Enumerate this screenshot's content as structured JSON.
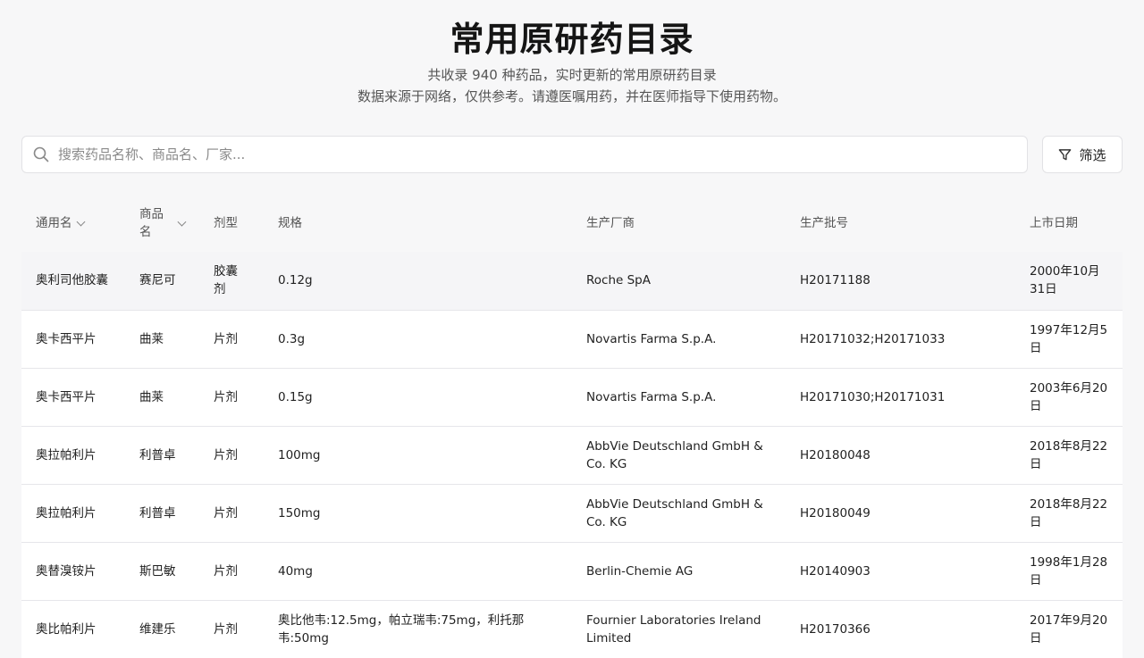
{
  "header": {
    "title": "常用原研药目录",
    "subtitle_line1": "共收录 940 种药品，实时更新的常用原研药目录",
    "subtitle_line2": "数据来源于网络，仅供参考。请遵医嘱用药，并在医师指导下使用药物。"
  },
  "search": {
    "placeholder": "搜索药品名称、商品名、厂家...",
    "value": ""
  },
  "filter": {
    "label": "筛选"
  },
  "table": {
    "columns": [
      "通用名",
      "商品名",
      "剂型",
      "规格",
      "生产厂商",
      "生产批号",
      "上市日期"
    ],
    "rows": [
      [
        "奥利司他胶囊",
        "赛尼可",
        "胶囊剂",
        "0.12g",
        "Roche SpA",
        "H20171188",
        "2000年10月31日"
      ],
      [
        "奥卡西平片",
        "曲莱",
        "片剂",
        "0.3g",
        "Novartis Farma S.p.A.",
        "H20171032;H20171033",
        "1997年12月5日"
      ],
      [
        "奥卡西平片",
        "曲莱",
        "片剂",
        "0.15g",
        "Novartis Farma S.p.A.",
        "H20171030;H20171031",
        "2003年6月20日"
      ],
      [
        "奥拉帕利片",
        "利普卓",
        "片剂",
        "100mg",
        "AbbVie Deutschland GmbH & Co. KG",
        "H20180048",
        "2018年8月22日"
      ],
      [
        "奥拉帕利片",
        "利普卓",
        "片剂",
        "150mg",
        "AbbVie Deutschland GmbH & Co. KG",
        "H20180049",
        "2018年8月22日"
      ],
      [
        "奥替溴铵片",
        "斯巴敏",
        "片剂",
        "40mg",
        "Berlin-Chemie AG",
        "H20140903",
        "1998年1月28日"
      ],
      [
        "奥比帕利片",
        "维建乐",
        "片剂",
        "奥比他韦:12.5mg，帕立瑞韦:75mg，利托那韦:50mg",
        "Fournier Laboratories Ireland Limited",
        "H20170366",
        "2017年9月20日"
      ]
    ]
  }
}
